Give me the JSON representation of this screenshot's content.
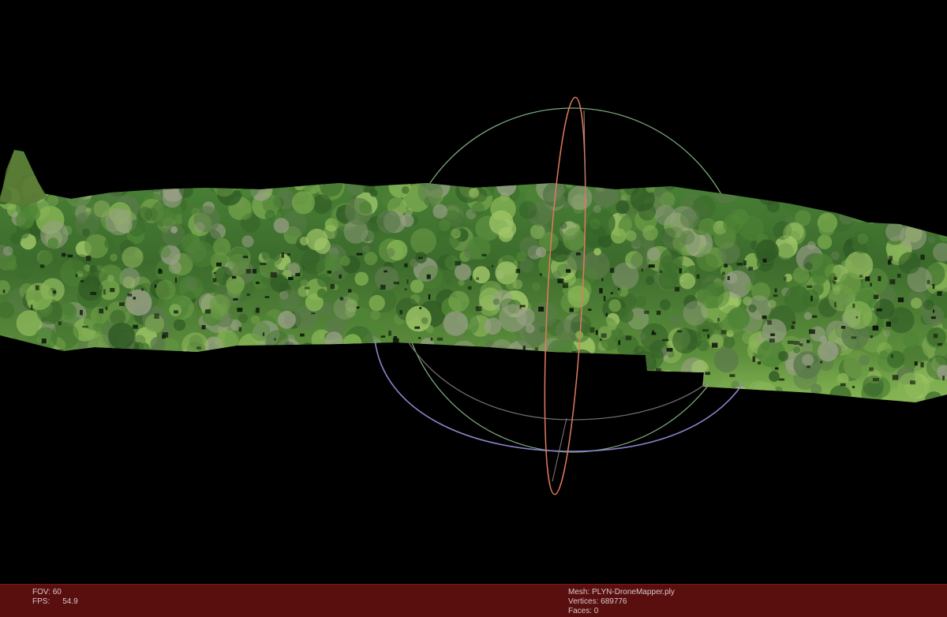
{
  "viewer": {
    "background": "#000000"
  },
  "gizmo": {
    "type": "rotation-gizmo",
    "colors": {
      "x_ring": "#e07a5f",
      "y_ring_upper": "#7aa87a",
      "y_ring_lower": "#8a84c8",
      "z_ring": "#8a8a8a"
    }
  },
  "mesh_render": {
    "type": "point-cloud-canopy",
    "palette": [
      "#2f5a24",
      "#3d6e2c",
      "#4f8536",
      "#6a9a45",
      "#86b455",
      "#a2c86a",
      "#5b7a4a",
      "#9aa088"
    ]
  },
  "status_bar": {
    "background": "#5a0f0f",
    "fov_label": "FOV: 60",
    "fps_label": "FPS:",
    "fps_value": "54.9",
    "mesh_label": "Mesh: PLYN-DroneMapper.ply",
    "vertices_label": "Vertices: 689776",
    "faces_label": "Faces: 0"
  }
}
